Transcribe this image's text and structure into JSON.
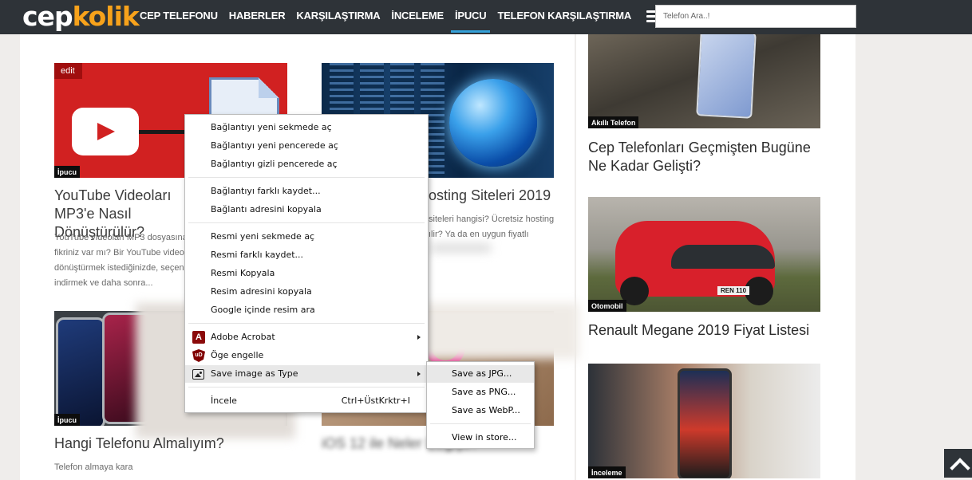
{
  "header": {
    "logo_part1": "cep",
    "logo_part2": "kolik",
    "nav": [
      "CEP TELEFONU",
      "HABERLER",
      "KARŞILAŞTIRMA",
      "İNCELEME",
      "İPUCU",
      "TELEFON KARŞILAŞTIRMA"
    ],
    "active_nav": "İPUCU",
    "search_placeholder": "Telefon Ara..!"
  },
  "articles": [
    {
      "edit_label": "edit",
      "badge": "İpucu",
      "title": "YouTube Videoları MP3'e Nasıl Dönüştürülür?",
      "excerpt_lines": [
        "YouTube videoları MP3 dosyasına",
        "fikriniz var mı? Bir YouTube videos",
        "dönüştürmek istediğinizde, seçen",
        "indirmek ve daha sonra..."
      ]
    },
    {
      "title_visible": "osting Siteleri 2019",
      "excerpt_lines": [
        "siteleri hangisi? Ücretsiz hosting",
        "ılir? Ya da en uygun fiyatlı"
      ]
    },
    {
      "badge": "İpucu",
      "title": "Hangi Telefonu Almalıyım?",
      "excerpt_lines": [
        "Telefon almaya kara"
      ]
    },
    {
      "title": "iOS 12 ile Neler Değişti?"
    }
  ],
  "sidebar": [
    {
      "badge": "Akıllı Telefon",
      "title": "Cep Telefonları Geçmişten Bugüne Ne Kadar Gelişti?"
    },
    {
      "badge": "Otomobil",
      "title": "Renault Megane 2019 Fiyat Listesi",
      "plate": "REN 110"
    },
    {
      "badge": "İnceleme"
    }
  ],
  "context_menu": {
    "items": [
      "Bağlantıyı yeni sekmede aç",
      "Bağlantıyı yeni pencerede aç",
      "Bağlantıyı gizli pencerede aç",
      "Bağlantıyı farklı kaydet...",
      "Bağlantı adresini kopyala",
      "Resmi yeni sekmede aç",
      "Resmi farklı kaydet...",
      "Resmi Kopyala",
      "Resim adresini kopyala",
      "Google içinde resim ara",
      "Adobe Acrobat",
      "Öge engelle",
      "Save image as Type",
      "İncele"
    ],
    "inspect_shortcut": "Ctrl+ÜstKrktr+I",
    "acrobat_icon": "acrobat-icon",
    "ublock_icon": "ublock-icon",
    "image_icon": "image-icon",
    "ublock_glyph": "uD"
  },
  "submenu": {
    "items": [
      "Save as JPG...",
      "Save as PNG...",
      "Save as WebP...",
      "View in store..."
    ]
  },
  "colors": {
    "header_bg": "#2e3338",
    "logo_accent": "#f7a21b",
    "active_underline": "#34a1d9",
    "menu_highlight": "#e8e8e8"
  }
}
